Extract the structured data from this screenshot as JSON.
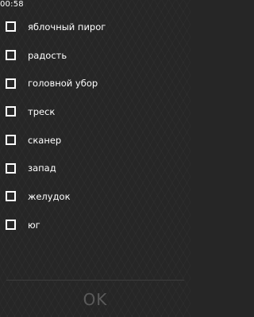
{
  "status_bar": {
    "time": "00:58"
  },
  "checklist": {
    "items": [
      {
        "label": "яблочный пирог",
        "checked": false,
        "icon": "checkbox-empty-icon"
      },
      {
        "label": "радость",
        "checked": false,
        "icon": "checkbox-empty-icon"
      },
      {
        "label": "головной убор",
        "checked": false,
        "icon": "checkbox-empty-icon"
      },
      {
        "label": "треск",
        "checked": false,
        "icon": "checkbox-empty-icon"
      },
      {
        "label": "сканер",
        "checked": false,
        "icon": "checkbox-empty-icon"
      },
      {
        "label": "запад",
        "checked": false,
        "icon": "checkbox-empty-icon"
      },
      {
        "label": "желудок",
        "checked": false,
        "icon": "checkbox-empty-icon"
      },
      {
        "label": "юг",
        "checked": false,
        "icon": "checkbox-empty-icon"
      }
    ]
  },
  "footer": {
    "ok_label": "OK",
    "ok_enabled": false
  },
  "colors": {
    "background": "#262626",
    "text": "#ffffff",
    "checkbox_border": "#ffffff",
    "ok_disabled": "#5a5a5a",
    "divider": "#3d3d3d"
  }
}
